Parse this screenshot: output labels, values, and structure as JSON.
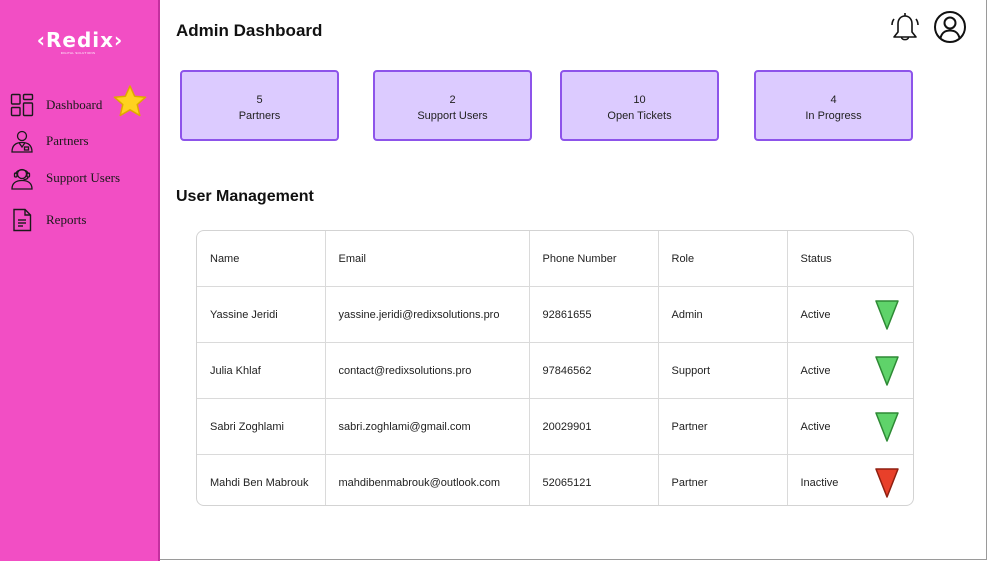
{
  "brand": {
    "logo": "‹Redix›",
    "tagline": "DIGITAL SOLUTIONS"
  },
  "sidebar": {
    "items": [
      {
        "label": "Dashboard",
        "icon": "dashboard-grid-icon"
      },
      {
        "label": "Partners",
        "icon": "partner-user-icon"
      },
      {
        "label": "Support Users",
        "icon": "headset-user-icon"
      },
      {
        "label": "Reports",
        "icon": "document-icon"
      }
    ],
    "active_marker_icon": "star-icon"
  },
  "header": {
    "title": "Admin Dashboard",
    "icons": [
      "bell-icon",
      "profile-icon"
    ]
  },
  "stats": [
    {
      "value": "5",
      "label": "Partners"
    },
    {
      "value": "2",
      "label": "Support Users"
    },
    {
      "value": "10",
      "label": "Open Tickets"
    },
    {
      "value": "4",
      "label": "In Progress"
    }
  ],
  "users": {
    "title": "User Management",
    "columns": [
      "Name",
      "Email",
      "Phone Number",
      "Role",
      "Status"
    ],
    "rows": [
      {
        "name": "Yassine Jeridi",
        "email": "yassine.jeridi@redixsolutions.pro",
        "phone": "92861655",
        "role": "Admin",
        "status": "Active"
      },
      {
        "name": "Julia Khlaf",
        "email": "contact@redixsolutions.pro",
        "phone": "97846562",
        "role": "Support",
        "status": "Active"
      },
      {
        "name": "Sabri Zoghlami",
        "email": "sabri.zoghlami@gmail.com",
        "phone": "20029901",
        "role": "Partner",
        "status": "Active"
      },
      {
        "name": "Mahdi Ben Mabrouk",
        "email": "mahdibenmabrouk@outlook.com",
        "phone": "52065121",
        "role": "Partner",
        "status": "Inactive"
      }
    ]
  },
  "colors": {
    "sidebar": "#f24ec4",
    "card_fill": "#dccbff",
    "card_border": "#8d54ea",
    "active_indicator": "#5fd36a",
    "inactive_indicator": "#e8402a",
    "star": "#ffd21f"
  }
}
